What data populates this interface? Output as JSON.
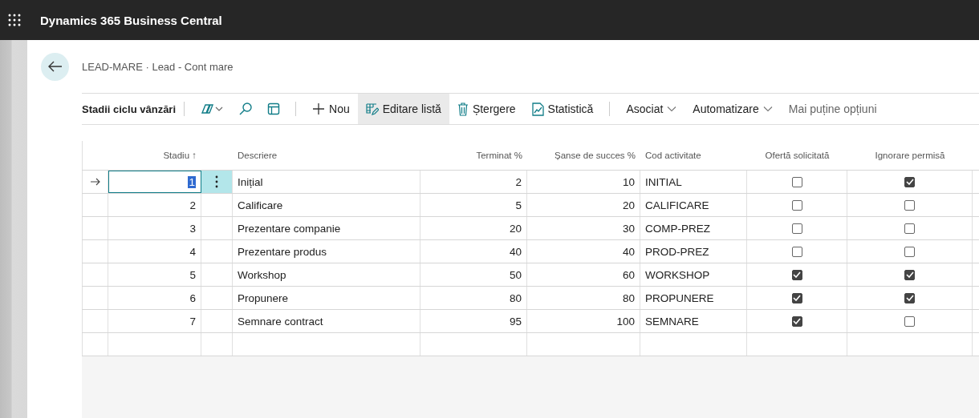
{
  "app": {
    "title": "Dynamics 365 Business Central"
  },
  "breadcrumb": "LEAD-MARE · Lead - Cont mare",
  "toolbar": {
    "title": "Stadii ciclu vânzări",
    "actions": [
      {
        "kind": "copilot"
      },
      {
        "kind": "search"
      },
      {
        "kind": "layout"
      },
      {
        "kind": "divider"
      },
      {
        "kind": "new",
        "label": "Nou",
        "selected": false
      },
      {
        "kind": "edit",
        "label": "Editare listă",
        "selected": true
      },
      {
        "kind": "delete",
        "label": "Ștergere",
        "selected": false
      },
      {
        "kind": "stats",
        "label": "Statistică",
        "selected": false
      },
      {
        "kind": "divider"
      },
      {
        "kind": "menu",
        "label": "Asociat"
      },
      {
        "kind": "menu",
        "label": "Automatizare"
      },
      {
        "kind": "link",
        "label": "Mai puține opțiuni"
      }
    ]
  },
  "table": {
    "columns": [
      "Stadiu ↑",
      "Descriere",
      "Terminat %",
      "Șanse de succes %",
      "Cod activitate",
      "Ofertă solicitată",
      "Ignorare permisă"
    ],
    "rows": [
      {
        "selected": true,
        "stage": "1",
        "description": "Inițial",
        "completed": "2",
        "chances": "10",
        "code": "INITIAL",
        "quote": false,
        "skip": true
      },
      {
        "selected": false,
        "stage": "2",
        "description": "Calificare",
        "completed": "5",
        "chances": "20",
        "code": "CALIFICARE",
        "quote": false,
        "skip": false
      },
      {
        "selected": false,
        "stage": "3",
        "description": "Prezentare companie",
        "completed": "20",
        "chances": "30",
        "code": "COMP-PREZ",
        "quote": false,
        "skip": false
      },
      {
        "selected": false,
        "stage": "4",
        "description": "Prezentare produs",
        "completed": "40",
        "chances": "40",
        "code": "PROD-PREZ",
        "quote": false,
        "skip": false
      },
      {
        "selected": false,
        "stage": "5",
        "description": "Workshop",
        "completed": "50",
        "chances": "60",
        "code": "WORKSHOP",
        "quote": true,
        "skip": true
      },
      {
        "selected": false,
        "stage": "6",
        "description": "Propunere",
        "completed": "80",
        "chances": "80",
        "code": "PROPUNERE",
        "quote": true,
        "skip": true
      },
      {
        "selected": false,
        "stage": "7",
        "description": "Semnare contract",
        "completed": "95",
        "chances": "100",
        "code": "SEMNARE",
        "quote": true,
        "skip": false
      }
    ]
  }
}
